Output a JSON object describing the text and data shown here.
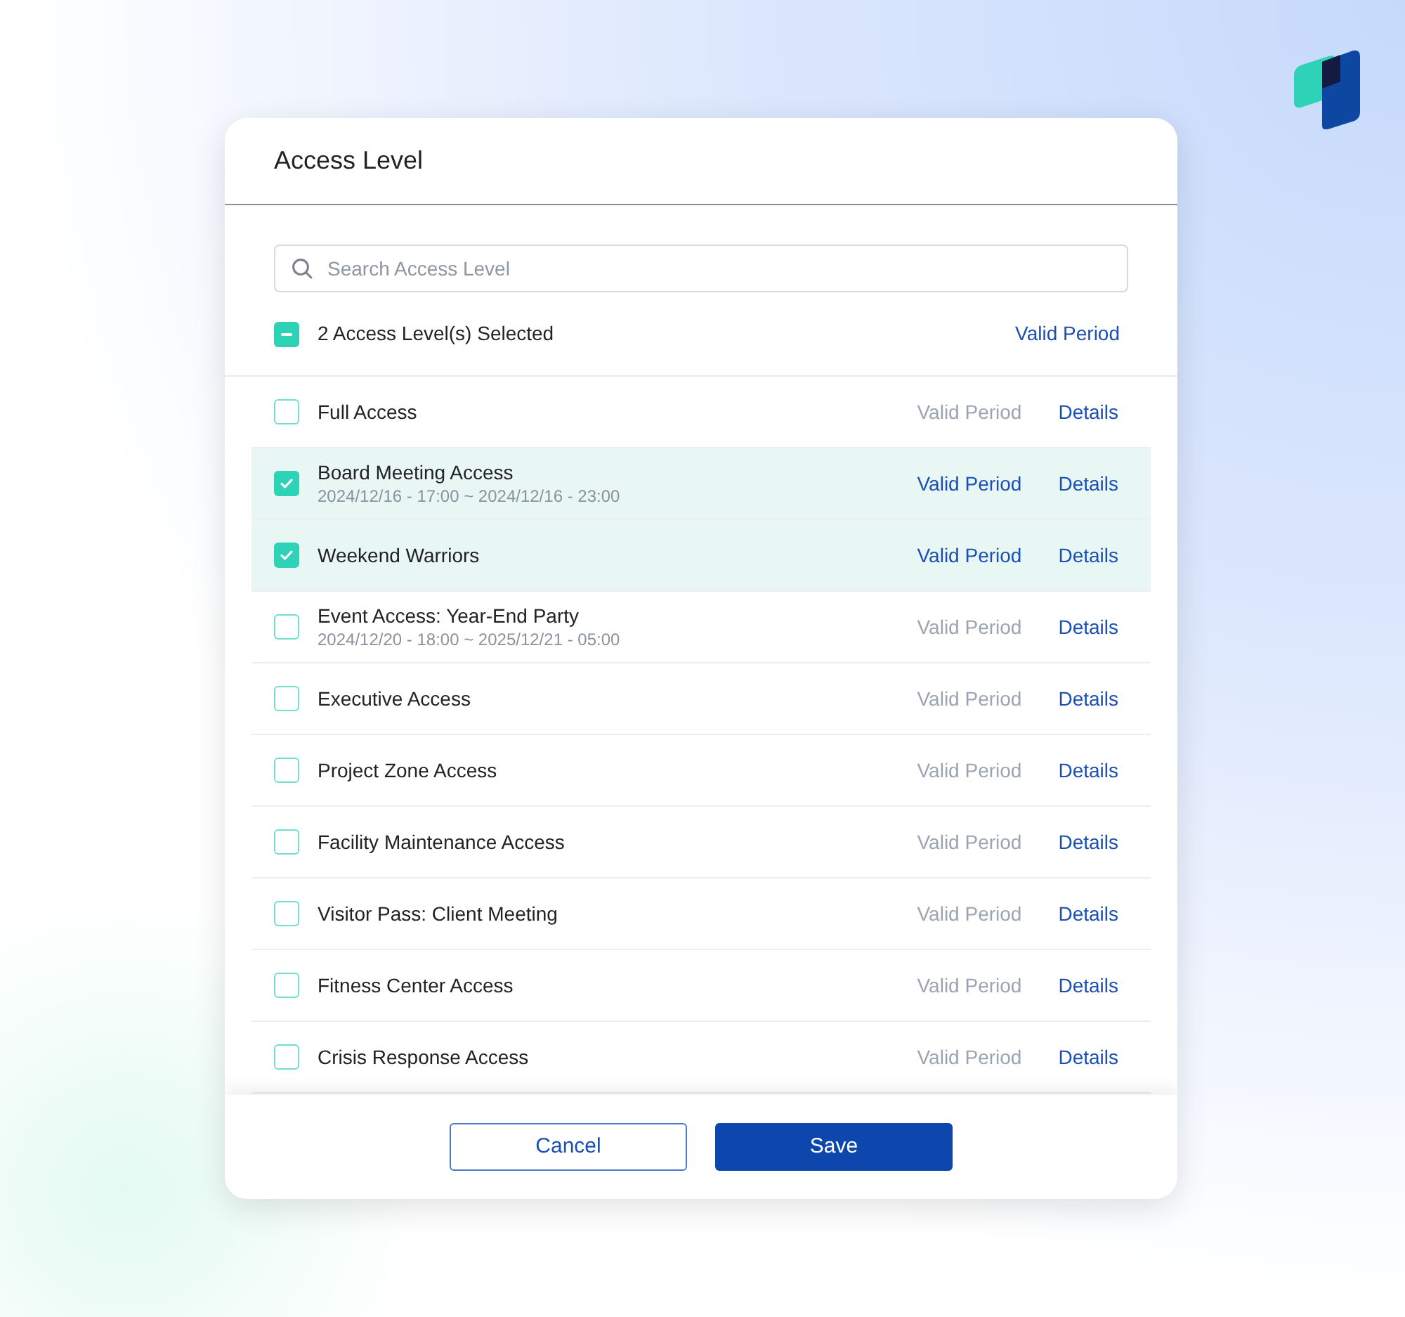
{
  "dialog": {
    "title": "Access Level"
  },
  "search": {
    "placeholder": "Search Access Level"
  },
  "select_all": {
    "indeterminate": true,
    "label": "2 Access Level(s) Selected",
    "link": "Valid Period"
  },
  "rows": [
    {
      "name": "Full Access",
      "checked": false,
      "valid_period": "Valid Period",
      "valid_period_enabled": false,
      "details": "Details"
    },
    {
      "name": "Board Meeting Access",
      "period": "2024/12/16 - 17:00 ~ 2024/12/16 - 23:00",
      "checked": true,
      "valid_period": "Valid Period",
      "valid_period_enabled": true,
      "details": "Details"
    },
    {
      "name": "Weekend Warriors",
      "checked": true,
      "valid_period": "Valid Period",
      "valid_period_enabled": true,
      "details": "Details"
    },
    {
      "name": "Event Access: Year-End Party",
      "period": "2024/12/20 - 18:00 ~ 2025/12/21 - 05:00",
      "checked": false,
      "valid_period": "Valid Period",
      "valid_period_enabled": false,
      "details": "Details"
    },
    {
      "name": "Executive Access",
      "checked": false,
      "valid_period": "Valid Period",
      "valid_period_enabled": false,
      "details": "Details"
    },
    {
      "name": "Project Zone Access",
      "checked": false,
      "valid_period": "Valid Period",
      "valid_period_enabled": false,
      "details": "Details"
    },
    {
      "name": "Facility Maintenance Access",
      "checked": false,
      "valid_period": "Valid Period",
      "valid_period_enabled": false,
      "details": "Details"
    },
    {
      "name": "Visitor Pass: Client Meeting",
      "checked": false,
      "valid_period": "Valid Period",
      "valid_period_enabled": false,
      "details": "Details"
    },
    {
      "name": "Fitness Center Access",
      "checked": false,
      "valid_period": "Valid Period",
      "valid_period_enabled": false,
      "details": "Details"
    },
    {
      "name": "Crisis Response Access",
      "checked": false,
      "valid_period": "Valid Period",
      "valid_period_enabled": false,
      "details": "Details"
    }
  ],
  "buttons": {
    "cancel": "Cancel",
    "save": "Save"
  }
}
